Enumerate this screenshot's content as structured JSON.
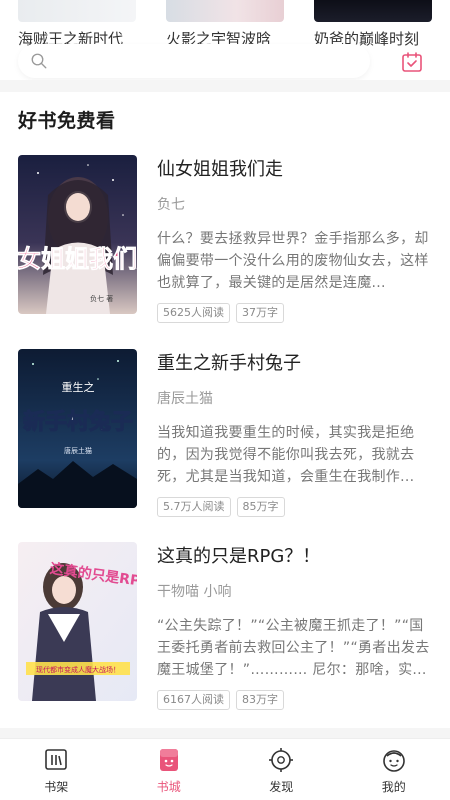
{
  "top_carousel": [
    {
      "title": "海贼王之新时代"
    },
    {
      "title": "火影之宇智波晗"
    },
    {
      "title": "奶爸的巅峰时刻"
    }
  ],
  "search": {
    "icon": "search-icon"
  },
  "section": {
    "title": "好书免费看"
  },
  "books": [
    {
      "title": "仙女姐姐我们走",
      "author": "负七",
      "description": "什么？要去拯救异世界？金手指那么多，却偏偏要带一个没什么用的废物仙女去，这样也就算了，最关键的是居然是连魔...",
      "readers": "5625人阅读",
      "words": "37万字",
      "cover_text": "仙女姐姐我们走",
      "cover_author": "负七 著"
    },
    {
      "title": "重生之新手村兔子",
      "author": "唐辰土猫",
      "description": "当我知道我要重生的时候，其实我是拒绝的，因为我觉得不能你叫我去死，我就去死，尤其是当我知道，会重生在我制作...",
      "readers": "5.7万人阅读",
      "words": "85万字",
      "cover_small": "重生之",
      "cover_big": "新手村兔子",
      "cover_author": "唐辰土猫"
    },
    {
      "title": "这真的只是RPG？！",
      "author": "干物喵 小响",
      "description": "“公主失踪了！”“公主被魔王抓走了！”“国王委托勇者前去救回公主了！”“勇者出发去魔王城堡了！”………… 尼尔：那啥，实...",
      "readers": "6167人阅读",
      "words": "83万字",
      "cover_text": "这真的只是RPG？！",
      "cover_small": "现代都市变成人魔大战场！"
    }
  ],
  "tabbar": [
    {
      "label": "书架",
      "icon": "bookshelf-icon"
    },
    {
      "label": "书城",
      "icon": "bookstore-icon",
      "active": true
    },
    {
      "label": "发现",
      "icon": "discover-icon"
    },
    {
      "label": "我的",
      "icon": "profile-icon"
    }
  ],
  "colors": {
    "accent": "#e9547a",
    "muted_text": "#9a9a9a",
    "background_gap": "#f5f5f5"
  }
}
